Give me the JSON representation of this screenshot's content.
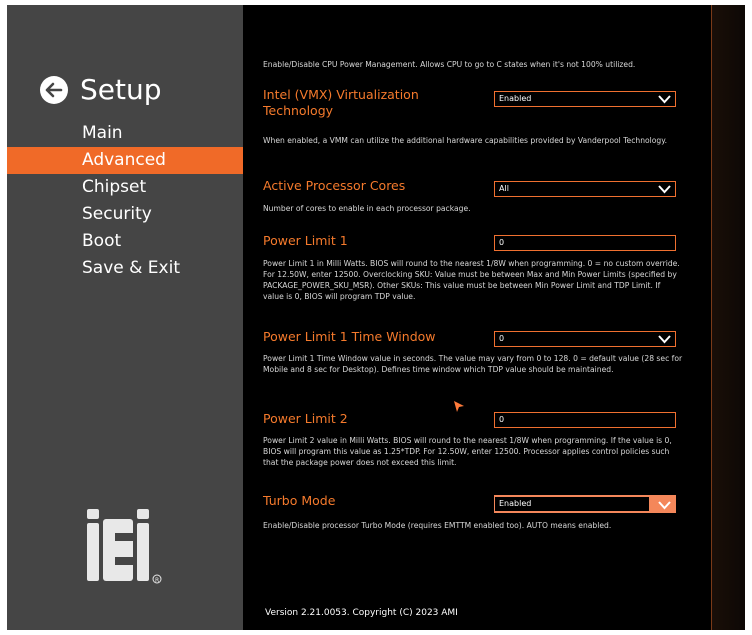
{
  "sidebar": {
    "title": "Setup",
    "menu": [
      {
        "label": "Main"
      },
      {
        "label": "Advanced"
      },
      {
        "label": "Chipset"
      },
      {
        "label": "Security"
      },
      {
        "label": "Boot"
      },
      {
        "label": "Save & Exit"
      }
    ],
    "active_index": 1,
    "logo_text": "iEi"
  },
  "main": {
    "top_help": "Enable/Disable CPU Power Management. Allows CPU to go to C states when it's not 100% utilized.",
    "settings": [
      {
        "label": "Intel (VMX) Virtualization Technology",
        "value": "Enabled",
        "type": "dropdown",
        "help": "When enabled, a VMM can utilize the additional hardware capabilities provided by Vanderpool Technology."
      },
      {
        "label": "Active Processor Cores",
        "value": "All",
        "type": "dropdown",
        "help": "Number of cores to enable in each processor package."
      },
      {
        "label": "Power Limit 1",
        "value": "0",
        "type": "input",
        "help": "Power Limit 1 in Milli Watts. BIOS will round to the nearest 1/8W when programming. 0 = no custom override. For 12.50W, enter 12500. Overclocking SKU: Value must be between Max and Min Power Limits (specified by PACKAGE_POWER_SKU_MSR). Other SKUs: This value must be between Min Power Limit and TDP Limit. If value is 0, BIOS will program TDP value."
      },
      {
        "label": "Power Limit 1 Time Window",
        "value": "0",
        "type": "dropdown",
        "help": "Power Limit 1 Time Window value in seconds. The value may vary from 0 to 128. 0 = default value (28 sec for Mobile and 8 sec for Desktop). Defines time window which TDP value should be maintained."
      },
      {
        "label": "Power Limit 2",
        "value": "0",
        "type": "input",
        "help": "Power Limit 2 value in Milli Watts. BIOS will round to the nearest 1/8W when programming. If the value is 0, BIOS will program this value as 1.25*TDP. For 12.50W, enter 12500. Processor applies control policies such that the package power does not exceed this limit."
      },
      {
        "label": "Turbo Mode",
        "value": "Enabled",
        "type": "dropdown",
        "selected": true,
        "help": "Enable/Disable processor Turbo Mode (requires EMTTM enabled too). AUTO means enabled."
      }
    ]
  },
  "footer": {
    "version": "Version 2.21.0053. Copyright (C) 2023 AMI"
  },
  "colors": {
    "accent": "#f06a28",
    "label": "#f57a2c",
    "sidebar_bg": "#454545",
    "main_bg": "#000000"
  }
}
